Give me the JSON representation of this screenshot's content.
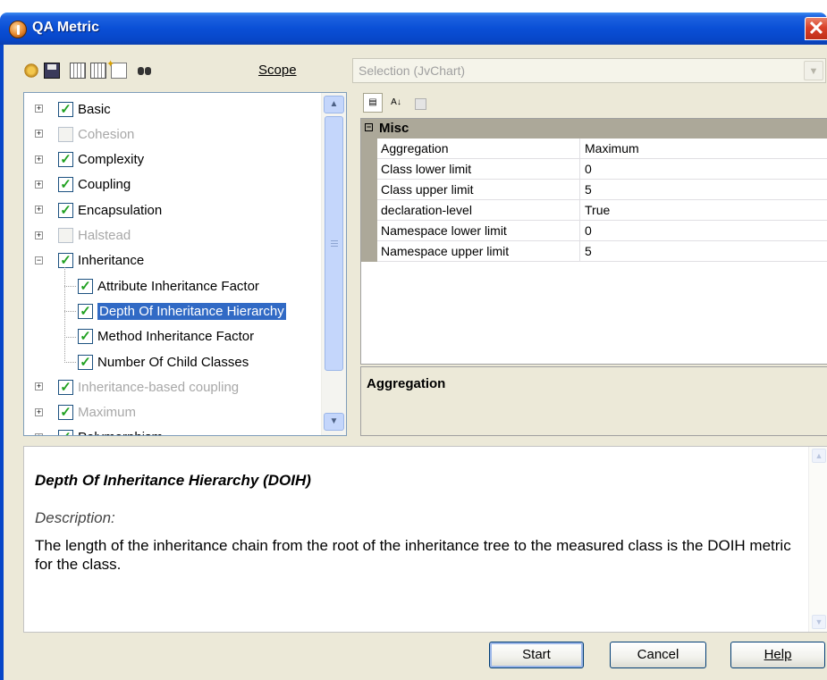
{
  "window": {
    "title": "QA Metric",
    "close_glyph": "✕"
  },
  "toolbar": {
    "icons": [
      "settings-icon",
      "save-icon",
      "grid-copy-icon",
      "grid-paste-icon",
      "new-item-icon",
      "find-icon"
    ],
    "scope_label": "Scope",
    "scope_value": "Selection (JvChart)"
  },
  "tree": {
    "items": [
      {
        "label": "Basic",
        "checked": true,
        "enabled": true
      },
      {
        "label": "Cohesion",
        "checked": false,
        "enabled": false
      },
      {
        "label": "Complexity",
        "checked": true,
        "enabled": true
      },
      {
        "label": "Coupling",
        "checked": true,
        "enabled": true
      },
      {
        "label": "Encapsulation",
        "checked": true,
        "enabled": true
      },
      {
        "label": "Halstead",
        "checked": false,
        "enabled": false
      },
      {
        "label": "Inheritance",
        "checked": true,
        "enabled": true,
        "expanded": true
      },
      {
        "label": "Attribute Inheritance Factor",
        "checked": true,
        "enabled": true,
        "child": true
      },
      {
        "label": "Depth Of Inheritance Hierarchy",
        "checked": true,
        "enabled": true,
        "child": true,
        "selected": true
      },
      {
        "label": "Method Inheritance Factor",
        "checked": true,
        "enabled": true,
        "child": true
      },
      {
        "label": "Number Of Child Classes",
        "checked": true,
        "enabled": true,
        "child": true
      },
      {
        "label": "Inheritance-based coupling",
        "checked": true,
        "enabled": false
      },
      {
        "label": "Maximum",
        "checked": true,
        "enabled": false
      },
      {
        "label": "Polymorphism",
        "checked": true,
        "enabled": true
      }
    ]
  },
  "properties": {
    "category": "Misc",
    "rows": [
      {
        "key": "Aggregation",
        "value": "Maximum"
      },
      {
        "key": "Class lower limit",
        "value": "0"
      },
      {
        "key": "Class upper limit",
        "value": "5"
      },
      {
        "key": "declaration-level",
        "value": "True"
      },
      {
        "key": "Namespace lower limit",
        "value": "0"
      },
      {
        "key": "Namespace upper limit",
        "value": "5"
      }
    ],
    "description_title": "Aggregation"
  },
  "description": {
    "title": "Depth Of Inheritance Hierarchy (DOIH)",
    "subtitle": "Description:",
    "body": "The length of the inheritance chain from the root of the inheritance tree to the measured class is the DOIH metric for the class."
  },
  "buttons": {
    "start": "Start",
    "cancel": "Cancel",
    "help": "Help"
  }
}
